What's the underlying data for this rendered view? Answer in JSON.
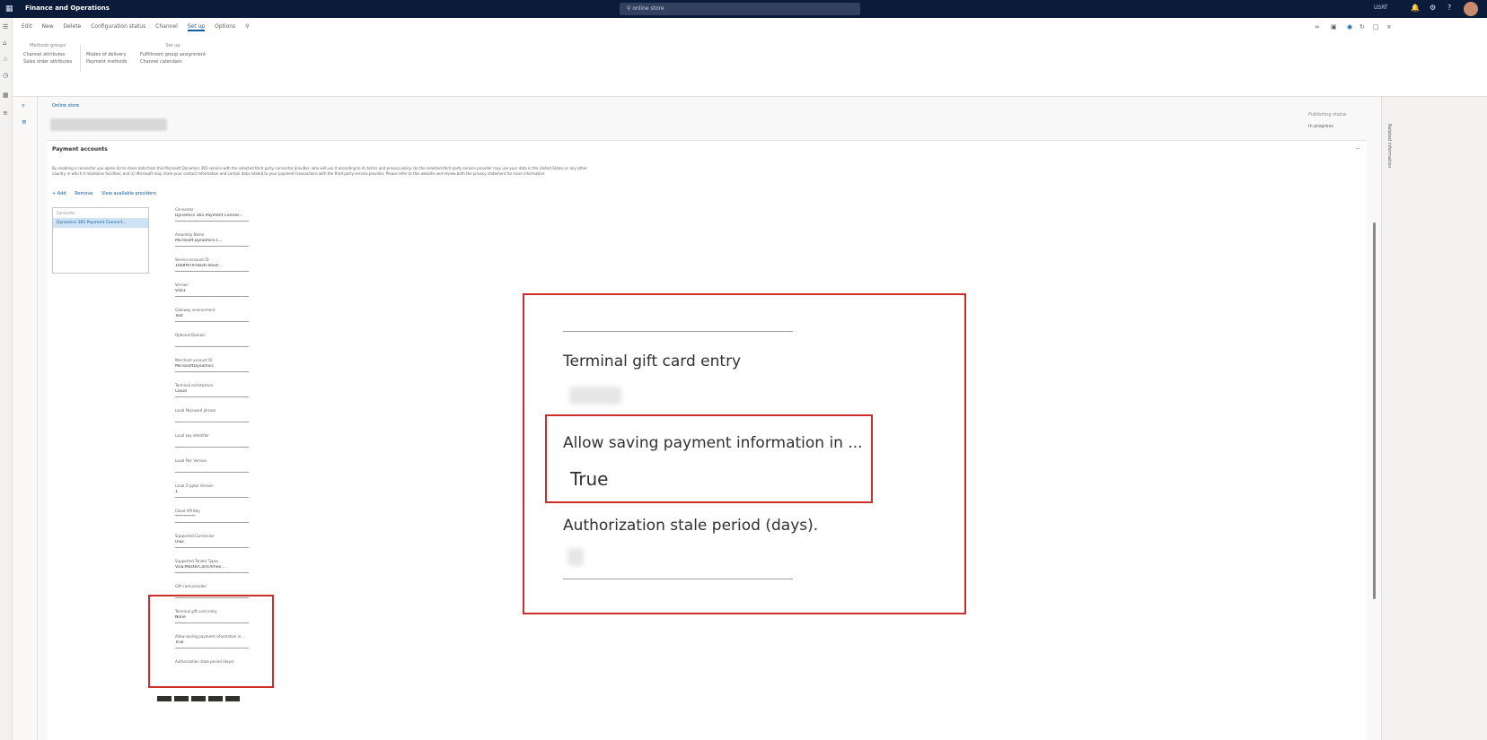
{
  "topbar": {
    "app_title": "Finance and Operations",
    "search_placeholder": "online store",
    "company": "USRT"
  },
  "toolbar": {
    "items": [
      "Edit",
      "New",
      "Delete",
      "Configuration status",
      "Channel",
      "Set up",
      "Options"
    ]
  },
  "action_groups": {
    "methods_title": "Methods groups",
    "methods_items": [
      "Channel attributes",
      "Sales order attributes"
    ],
    "setup_title": "Set up",
    "setup_col1": [
      "Modes of delivery",
      "Payment methods"
    ],
    "setup_col2": [
      "Fulfillment group assignment",
      "Channel calendars"
    ]
  },
  "page": {
    "breadcrumb": "Online store",
    "operating_status_label": "Publishing status",
    "operating_status_value": "In progress"
  },
  "fasttab": {
    "title": "Payment accounts",
    "description": "By enabling a connector you agree (a) to share data from this Microsoft Dynamics 365 service with the selected third party connector provider, who will use it according to its terms and privacy policy. (b) the selected third party service provider may use your data in the United States or any other country in which it maintains facilities; and (c) Microsoft may share your contact information and certain data related to your payment transactions with the third-party service provider. Please refer to this website and review both the privacy statement for more information.",
    "tools": [
      "+ Add",
      "Remove",
      "View available providers"
    ]
  },
  "connector_grid": {
    "header": "Connector",
    "row": "Dynamics 365 Payment Connect..."
  },
  "fields": [
    {
      "label": "Connector",
      "value": "Dynamics 365 Payment Connec..."
    },
    {
      "label": "Assembly Name",
      "value": "Microsoft.Dynamics.C..."
    },
    {
      "label": "Service account ID",
      "value": "16b8f979-0826-4aad-..."
    },
    {
      "label": "Version",
      "value": "V001"
    },
    {
      "label": "Gateway environment",
      "value": "Test"
    },
    {
      "label": "Optional Domain",
      "value": ""
    },
    {
      "label": "Merchant account ID",
      "value": "MicrosoftDynamics"
    },
    {
      "label": "Terminal architecture",
      "value": "Cloud"
    },
    {
      "label": "Local Password phrase",
      "value": ""
    },
    {
      "label": "Local key identifier",
      "value": ""
    },
    {
      "label": "Local Pair Version",
      "value": ""
    },
    {
      "label": "Local Cryptor Version",
      "value": "1"
    },
    {
      "label": "Cloud API Key",
      "value": "**********"
    },
    {
      "label": "Supported Currencies",
      "value": "USD"
    },
    {
      "label": "Supported Tender Types",
      "value": "Visa;MasterCard;Amex;..."
    },
    {
      "label": "Gift card provider",
      "value": ""
    },
    {
      "label": "Terminal gift card entry",
      "value": "None"
    },
    {
      "label": "Allow saving payment information in ...",
      "value": "True"
    },
    {
      "label": "Authorization stale period (days)",
      "value": ""
    }
  ],
  "zoom": {
    "label1": "Terminal gift card entry",
    "label2": "Allow saving payment information in ...",
    "value2": "True",
    "label3": "Authorization stale period (days)."
  },
  "rightpanel": {
    "title": "Related information"
  }
}
